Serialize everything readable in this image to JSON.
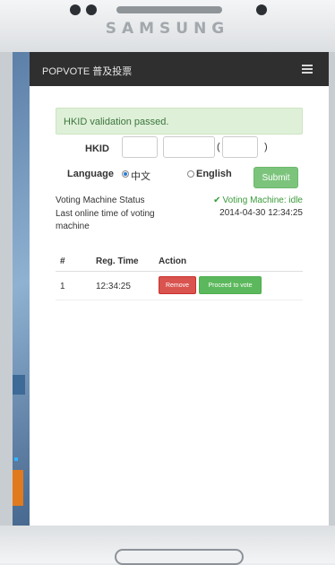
{
  "device": {
    "brand": "SAMSUNG"
  },
  "navbar": {
    "title": "POPVOTE 普及投票"
  },
  "alert": {
    "message": "HKID validation passed."
  },
  "form": {
    "hkid_label": "HKID",
    "paren_open": "(",
    "paren_close": ")",
    "language_label": "Language",
    "language_options": [
      "中文",
      "English"
    ],
    "selected_language": "中文",
    "submit_label": "Submit"
  },
  "status": {
    "machine_label": "Voting Machine Status",
    "machine_value": "Voting Machine: idle",
    "online_label": "Last online time of voting machine",
    "online_value": "2014-04-30 12:34:25"
  },
  "table": {
    "headers": [
      "#",
      "Reg. Time",
      "Action"
    ],
    "rows": [
      {
        "num": "1",
        "time": "12:34:25",
        "remove_label": "Remove",
        "vote_label": "Proceed to vote"
      }
    ]
  },
  "colors": {
    "navbar": "#2f2f2f",
    "alert_bg": "#dff0d8",
    "alert_text": "#3c763d",
    "success": "#5cb85c",
    "danger": "#d9534f"
  }
}
